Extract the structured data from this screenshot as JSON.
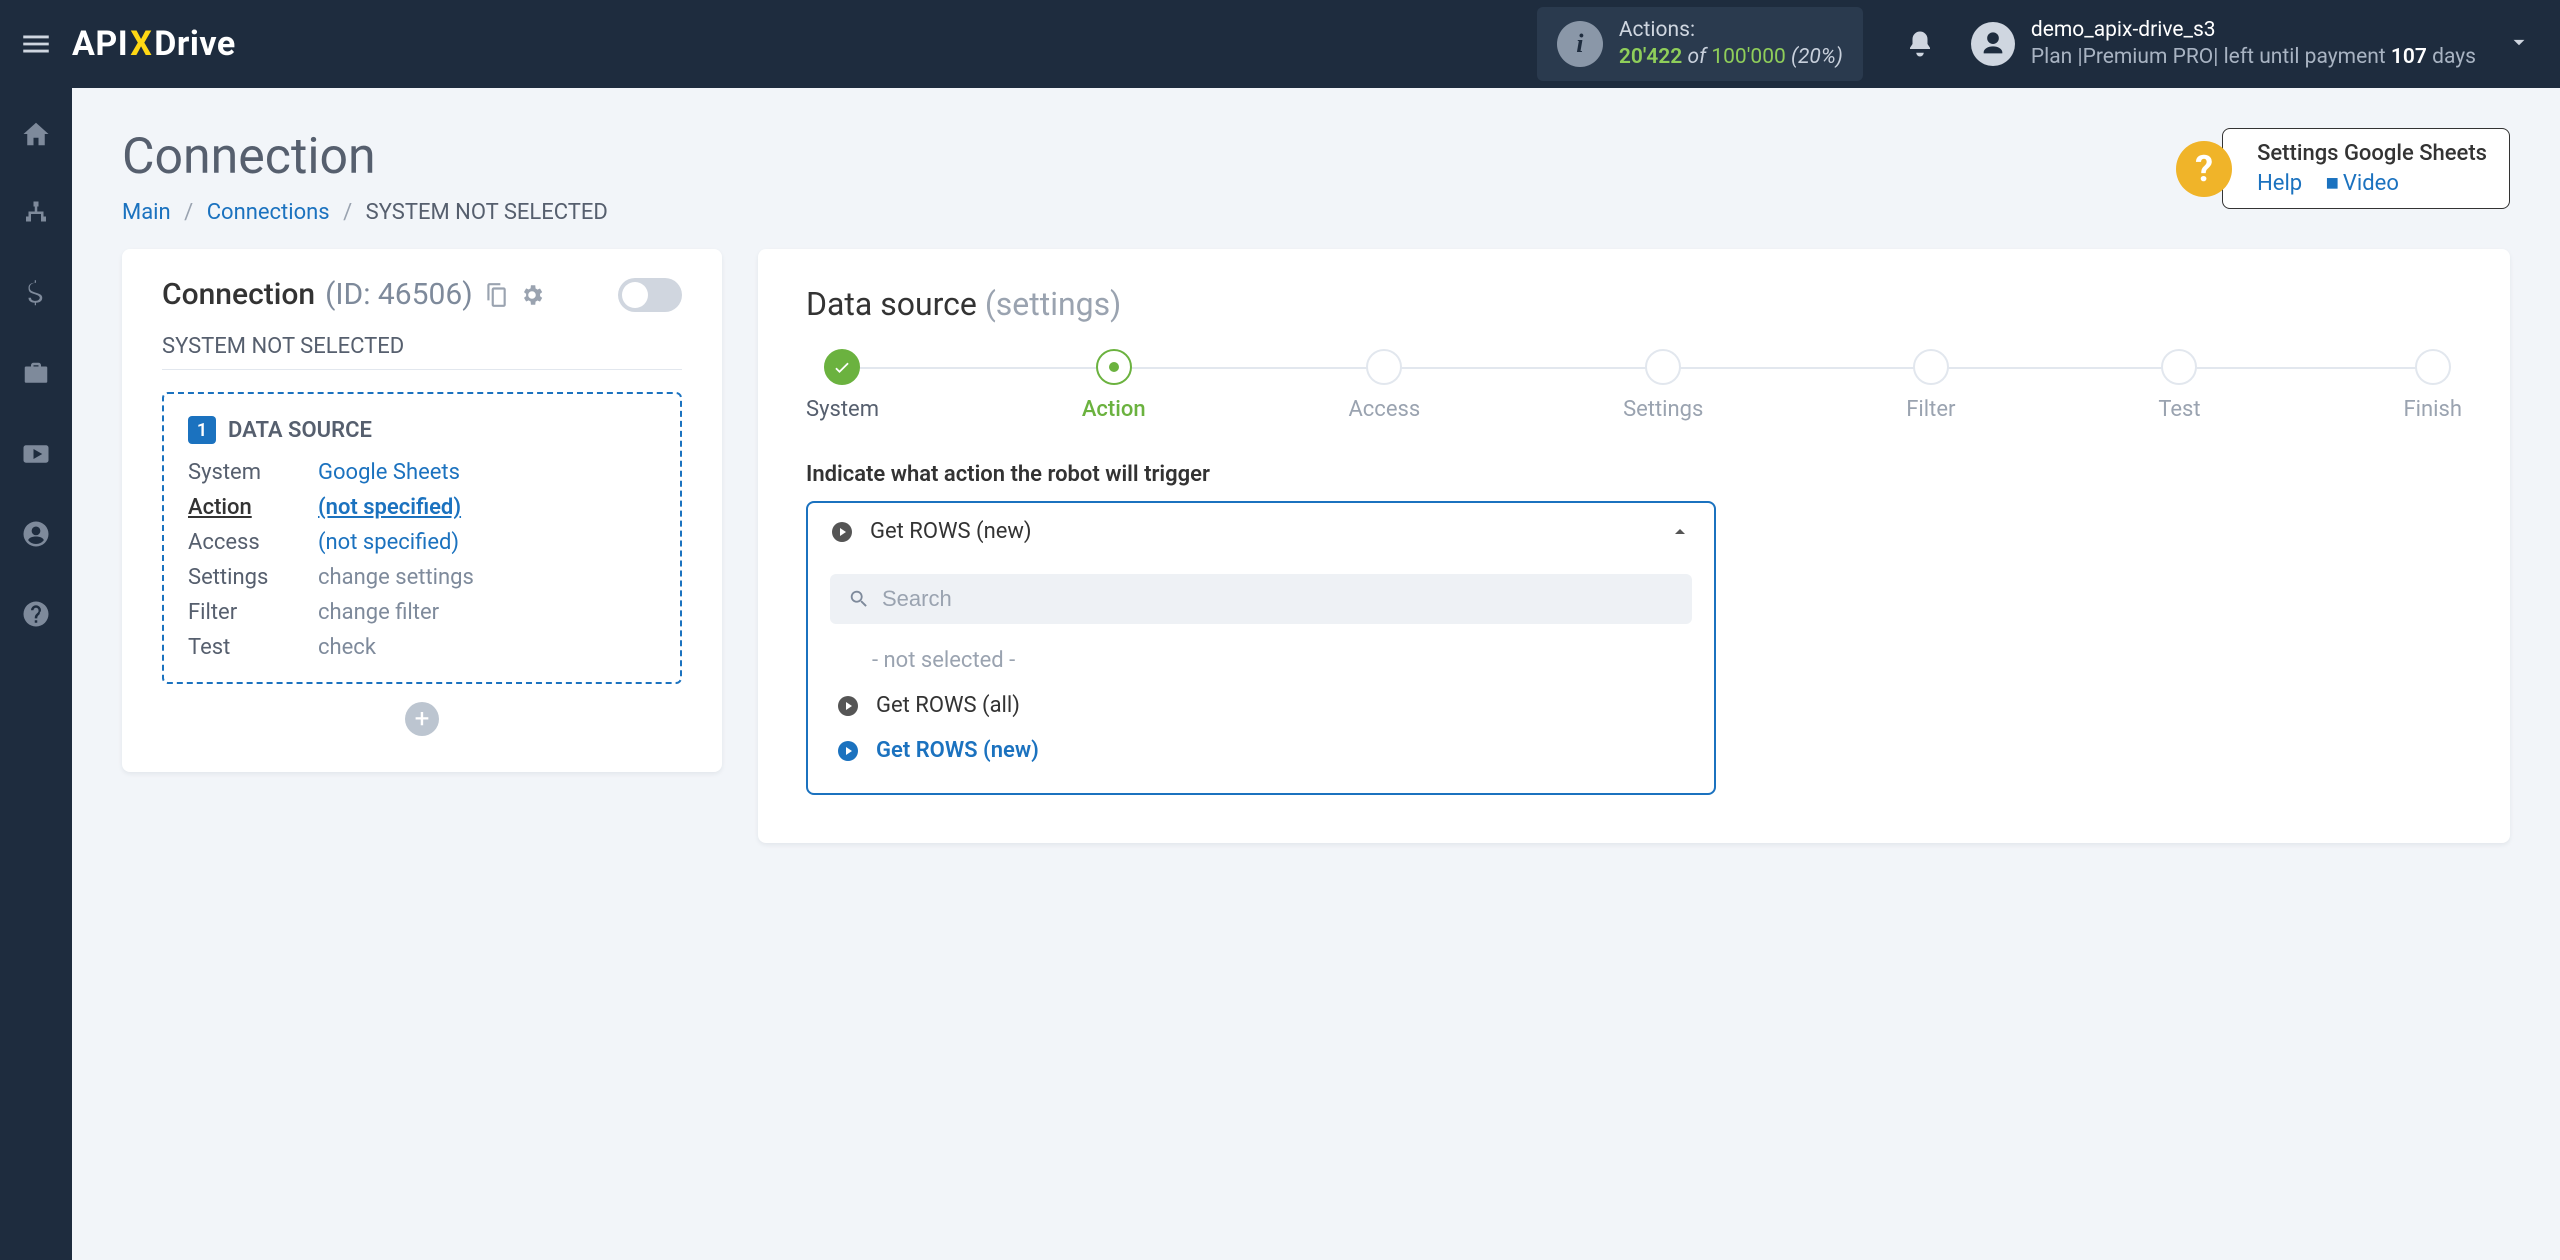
{
  "brand": {
    "pre": "API",
    "x": "X",
    "post": "Drive"
  },
  "topbar": {
    "actions_label": "Actions:",
    "actions_current": "20'422",
    "actions_of": " of ",
    "actions_total": "100'000",
    "actions_pct": " (20%)",
    "user_name": "demo_apix-drive_s3",
    "plan_prefix": "Plan |Premium PRO| left until payment ",
    "plan_days": "107",
    "plan_suffix": " days"
  },
  "page": {
    "title": "Connection",
    "breadcrumb": {
      "main": "Main",
      "connections": "Connections",
      "current": "SYSTEM NOT SELECTED"
    }
  },
  "help": {
    "title": "Settings Google Sheets",
    "help": "Help",
    "video": "Video"
  },
  "left": {
    "conn_label": "Connection",
    "conn_id": "(ID: 46506)",
    "subtitle": "SYSTEM NOT SELECTED",
    "ds_title": "DATA SOURCE",
    "ds_num": "1",
    "rows": {
      "system": {
        "label": "System",
        "value": "Google Sheets"
      },
      "action": {
        "label": "Action",
        "value": "(not specified)"
      },
      "access": {
        "label": "Access",
        "value": "(not specified)"
      },
      "settings": {
        "label": "Settings",
        "value": "change settings"
      },
      "filter": {
        "label": "Filter",
        "value": "change filter"
      },
      "test": {
        "label": "Test",
        "value": "check"
      }
    }
  },
  "right": {
    "title": "Data source",
    "title_muted": "(settings)",
    "steps": [
      "System",
      "Action",
      "Access",
      "Settings",
      "Filter",
      "Test",
      "Finish"
    ],
    "field_label": "Indicate what action the robot will trigger",
    "selected": "Get ROWS (new)",
    "search_placeholder": "Search",
    "options": {
      "not_selected": "- not selected -",
      "opt1": "Get ROWS (all)",
      "opt2": "Get ROWS (new)"
    }
  }
}
